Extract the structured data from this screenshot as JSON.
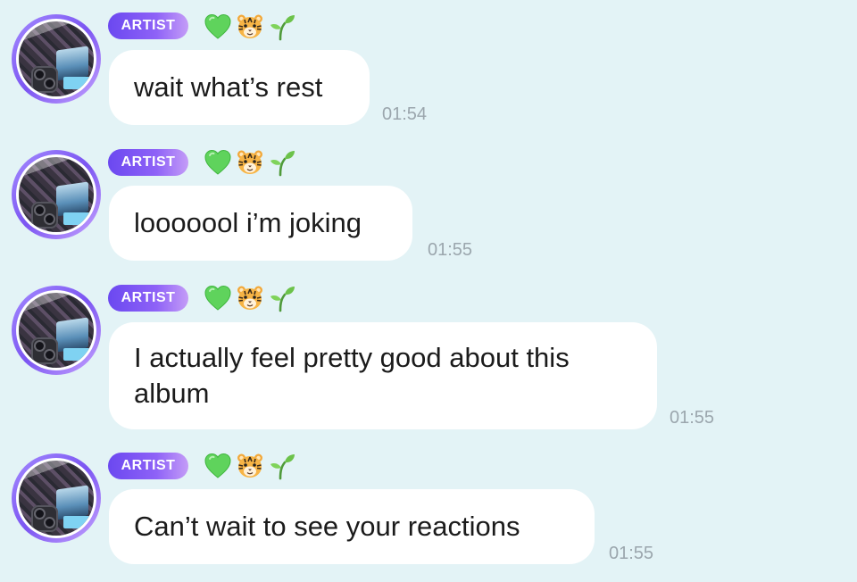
{
  "chat": {
    "messages": [
      {
        "badge": "ARTIST",
        "text": "wait what’s rest",
        "time": "01:54",
        "emojis": [
          "green-heart",
          "tiger-face",
          "seedling"
        ]
      },
      {
        "badge": "ARTIST",
        "text": "looooool i’m joking",
        "time": "01:55",
        "emojis": [
          "green-heart",
          "tiger-face",
          "seedling"
        ]
      },
      {
        "badge": "ARTIST",
        "text": "I actually feel pretty good about this album",
        "time": "01:55",
        "emojis": [
          "green-heart",
          "tiger-face",
          "seedling"
        ]
      },
      {
        "badge": "ARTIST",
        "text": "Can’t wait to see your reactions",
        "time": "01:55",
        "emojis": [
          "green-heart",
          "tiger-face",
          "seedling"
        ]
      }
    ]
  },
  "colors": {
    "background": "#e3f3f6",
    "badge_gradient_start": "#6b48f0",
    "badge_gradient_end": "#c49cf7",
    "bubble": "#ffffff",
    "timestamp": "#9ba6ad"
  }
}
